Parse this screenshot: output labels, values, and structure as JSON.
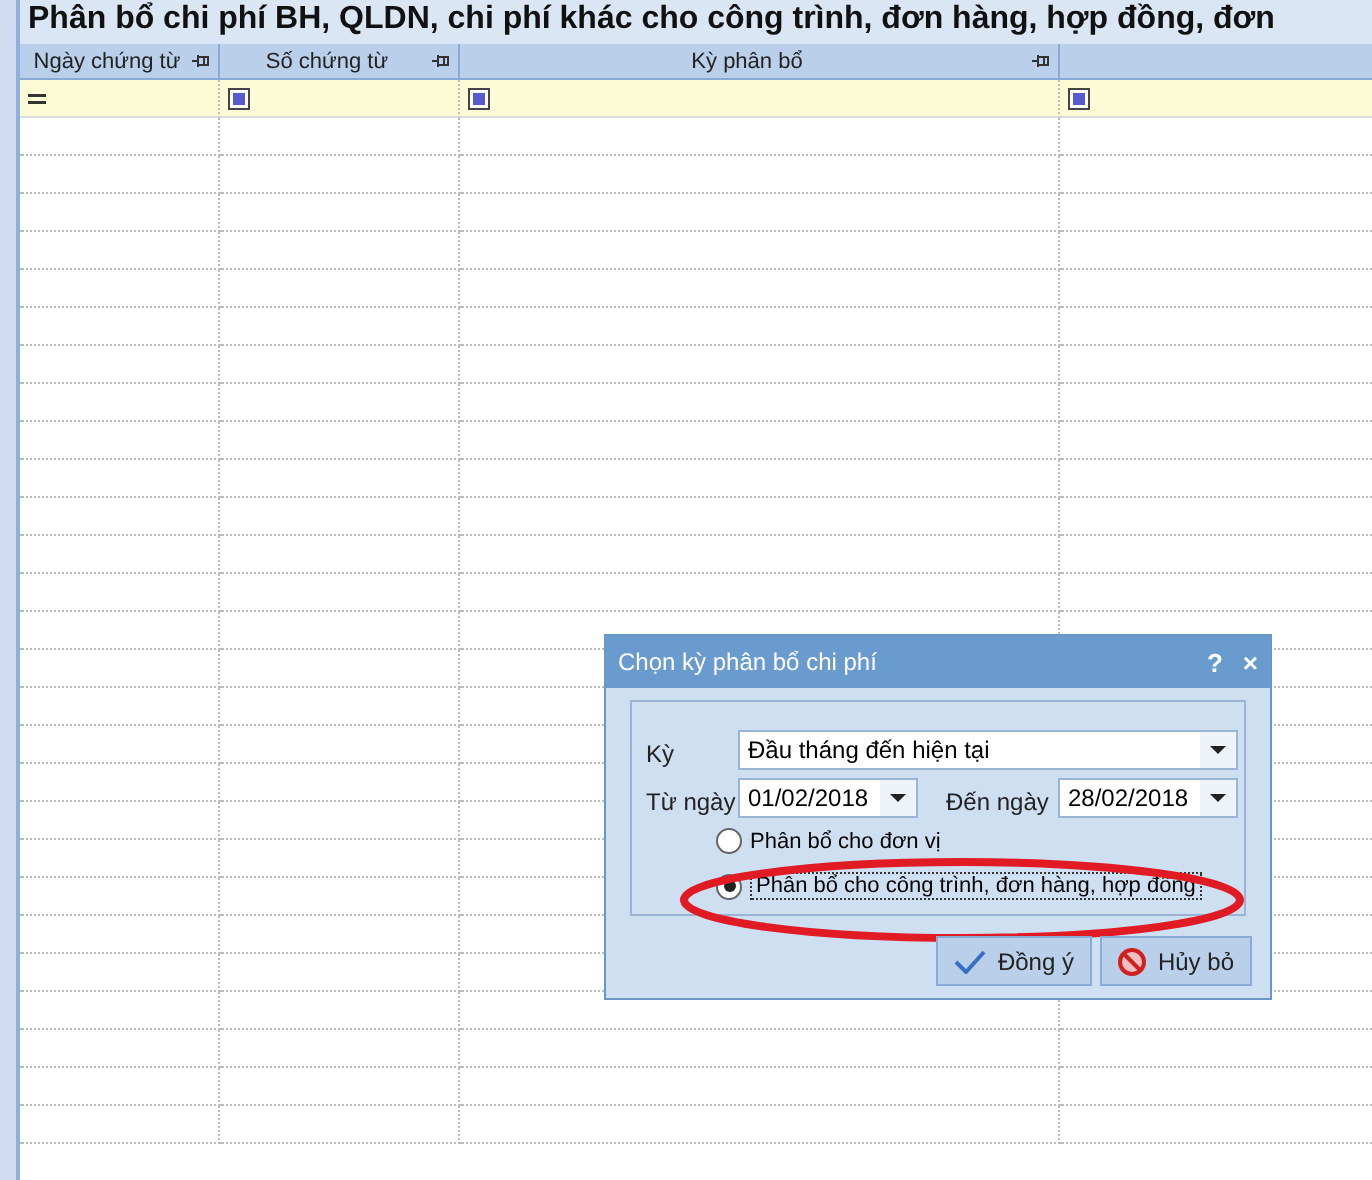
{
  "title": "Phân bổ chi phí BH, QLDN, chi phí khác cho công trình, đơn hàng, hợp đồng, đơn",
  "table": {
    "columns": [
      {
        "label": "Ngày chứng từ",
        "kind": "equals"
      },
      {
        "label": "Số chứng từ",
        "kind": "square"
      },
      {
        "label": "Kỳ phân bổ",
        "kind": "square"
      },
      {
        "kind": "square"
      }
    ]
  },
  "dialog": {
    "title": "Chọn kỳ phân bổ chi phí",
    "help": "?",
    "close": "×",
    "period": {
      "label": "Kỳ",
      "value": "Đầu tháng đến hiện tại"
    },
    "from": {
      "label": "Từ ngày",
      "value": "01/02/2018"
    },
    "to": {
      "label": "Đến ngày",
      "value": "28/02/2018"
    },
    "options": [
      {
        "label": "Phân bổ cho đơn vị",
        "selected": false
      },
      {
        "label": "Phân bổ cho công trình, đơn hàng, hợp đồng",
        "selected": true
      }
    ],
    "buttons": [
      {
        "label": "Đồng ý",
        "kind": "ok"
      },
      {
        "label": "Hủy bỏ",
        "kind": "cancel"
      }
    ]
  }
}
